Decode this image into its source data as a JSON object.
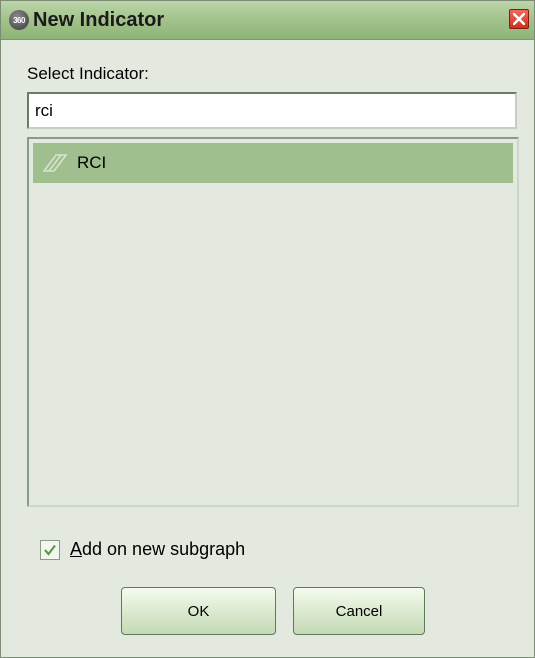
{
  "window": {
    "title": "New Indicator",
    "app_icon_text": "360",
    "icons": {
      "app": "app-logo-icon",
      "close": "close-icon"
    },
    "close_color": "#e0402e",
    "titlebar_color": "#a4c48e"
  },
  "select_label": "Select Indicator:",
  "search": {
    "value": "rci",
    "placeholder": ""
  },
  "list": {
    "items": [
      {
        "label": "RCI",
        "icon": "indicator-icon",
        "selected": true
      }
    ],
    "selected_color": "#9fbf8f"
  },
  "checkbox": {
    "label_mnemonic": "A",
    "label_rest": "dd on new subgraph",
    "checked": true
  },
  "buttons": {
    "ok": "OK",
    "cancel": "Cancel"
  }
}
